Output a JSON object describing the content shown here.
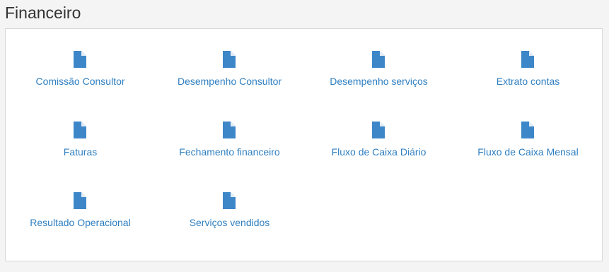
{
  "page": {
    "title": "Financeiro"
  },
  "colors": {
    "link": "#2f7fc1",
    "icon": "#3d87c9",
    "title": "#333333",
    "background": "#f4f4f4",
    "panel": "#ffffff"
  },
  "reports": [
    {
      "label": "Comissão Consultor",
      "icon": "document-icon"
    },
    {
      "label": "Desempenho Consultor",
      "icon": "document-icon"
    },
    {
      "label": "Desempenho serviços",
      "icon": "document-icon"
    },
    {
      "label": "Extrato contas",
      "icon": "document-icon"
    },
    {
      "label": "Faturas",
      "icon": "document-icon"
    },
    {
      "label": "Fechamento financeiro",
      "icon": "document-icon"
    },
    {
      "label": "Fluxo de Caixa Diário",
      "icon": "document-icon"
    },
    {
      "label": "Fluxo de Caixa Mensal",
      "icon": "document-icon"
    },
    {
      "label": "Resultado Operacional",
      "icon": "document-icon"
    },
    {
      "label": "Serviços vendidos",
      "icon": "document-icon"
    }
  ]
}
